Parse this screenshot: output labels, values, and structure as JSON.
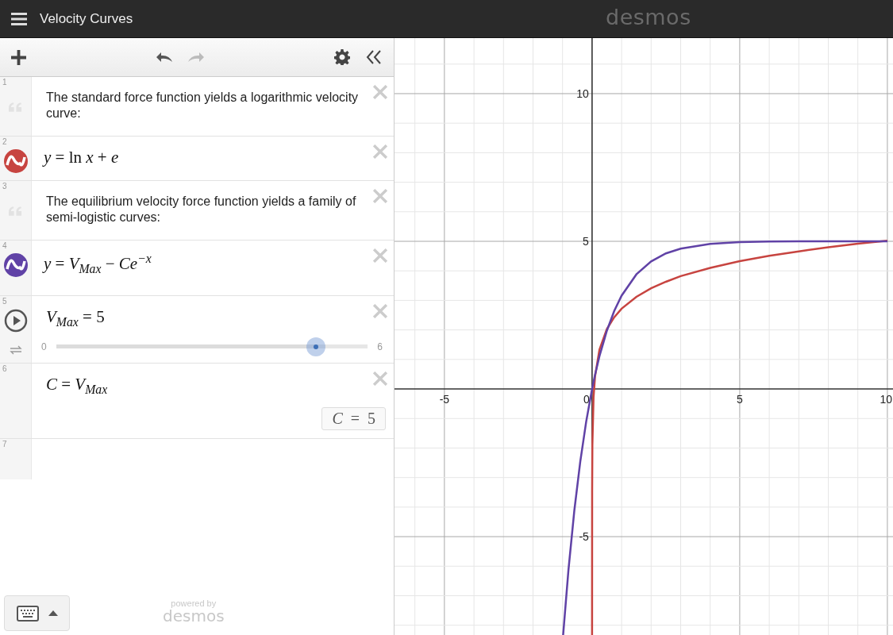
{
  "header": {
    "title": "Velocity Curves",
    "logo": "desmos"
  },
  "expressions": [
    {
      "number": "1",
      "kind": "note",
      "text": "The standard force function yields a logarithmic velocity curve:"
    },
    {
      "number": "2",
      "kind": "expression",
      "color": "#c74440",
      "math": "*y* = ln *x* + *e*"
    },
    {
      "number": "3",
      "kind": "note",
      "text": "The equilibrium velocity force function yields a family of semi-logistic curves:"
    },
    {
      "number": "4",
      "kind": "expression",
      "color": "#6042a6",
      "math": "*y* = *V*$_{Max}$ − *Ce*$^{−x}$"
    },
    {
      "number": "5",
      "kind": "slider",
      "math": "*V*$_{Max}$ = 5",
      "min": "0",
      "max": "6",
      "level": 0.8333
    },
    {
      "number": "6",
      "kind": "result",
      "math": "*C* = *V*$_{Max}$",
      "result": "*C*  =  5"
    },
    {
      "number": "7",
      "kind": "empty"
    }
  ],
  "footer": {
    "powered_by": "powered by",
    "brand": "desmos"
  },
  "graph": {
    "chart_data": {
      "type": "line",
      "x": [
        -0.98,
        -0.8,
        -0.6,
        -0.4,
        -0.2,
        0,
        1.6e-05,
        0.002,
        0.01,
        0.05,
        0.1,
        0.25,
        0.5,
        0.75,
        1,
        1.5,
        2,
        2.5,
        3,
        4,
        5,
        6,
        7,
        8,
        9,
        10
      ],
      "series": [
        {
          "color": "#c74440",
          "values": [
            null,
            null,
            null,
            null,
            null,
            null,
            -8.33,
            -3.5,
            -1.89,
            -0.28,
            0.42,
            1.33,
            2.03,
            2.43,
            2.72,
            3.12,
            3.41,
            3.63,
            3.82,
            4.1,
            4.33,
            4.51,
            4.66,
            4.8,
            4.92,
            5.02
          ]
        },
        {
          "color": "#6042a6",
          "values": [
            -8.33,
            -6.13,
            -4.11,
            -2.46,
            -1.11,
            0,
            0,
            0.01,
            0.05,
            0.24,
            0.48,
            1.11,
            1.97,
            2.64,
            3.16,
            3.88,
            4.32,
            4.59,
            4.75,
            4.91,
            4.97,
            4.99,
            5,
            5,
            5,
            5
          ]
        }
      ],
      "xlim": [
        -6.69,
        10.19
      ],
      "ylim": [
        -8.33,
        11.88
      ],
      "xticks": [
        -5,
        0,
        5,
        10
      ],
      "yticks": [
        -5,
        5,
        10
      ],
      "grid": true
    }
  }
}
